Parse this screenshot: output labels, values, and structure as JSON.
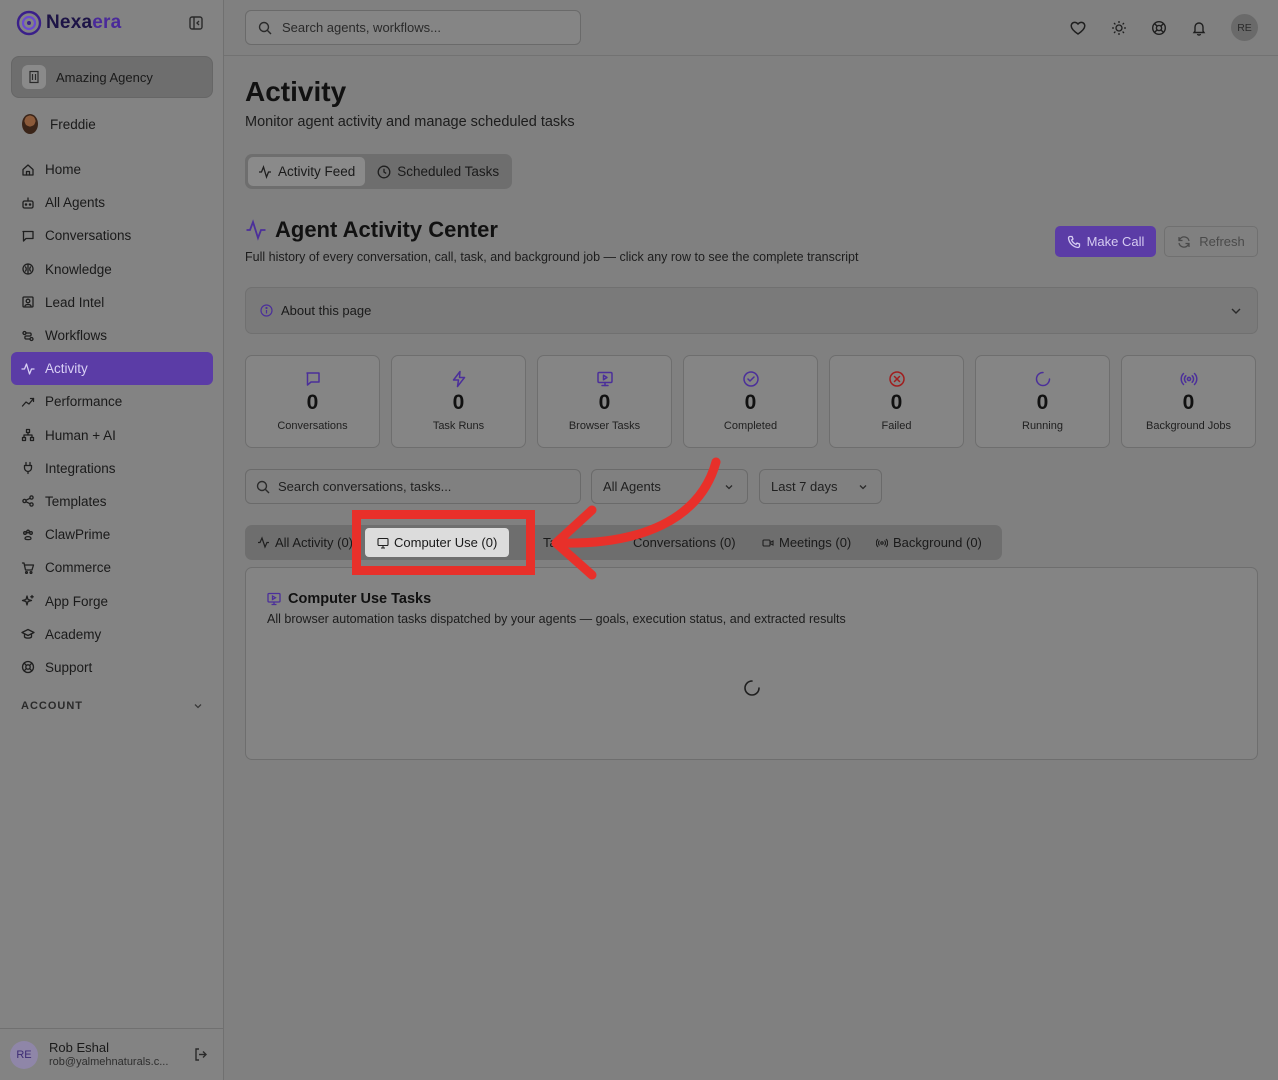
{
  "brand": {
    "name_part1": "Nexa",
    "name_part2": "era"
  },
  "sidebar": {
    "agency": "Amazing Agency",
    "user": "Freddie",
    "items": [
      {
        "label": "Home",
        "icon": "home-icon"
      },
      {
        "label": "All Agents",
        "icon": "bot-icon"
      },
      {
        "label": "Conversations",
        "icon": "message-icon"
      },
      {
        "label": "Knowledge",
        "icon": "brain-icon"
      },
      {
        "label": "Lead Intel",
        "icon": "contact-icon"
      },
      {
        "label": "Workflows",
        "icon": "workflow-icon"
      },
      {
        "label": "Activity",
        "icon": "activity-icon",
        "active": true
      },
      {
        "label": "Performance",
        "icon": "trending-icon"
      },
      {
        "label": "Human + AI",
        "icon": "network-icon"
      },
      {
        "label": "Integrations",
        "icon": "plug-icon"
      },
      {
        "label": "Templates",
        "icon": "share-icon"
      },
      {
        "label": "ClawPrime",
        "icon": "paw-icon"
      },
      {
        "label": "Commerce",
        "icon": "cart-icon"
      },
      {
        "label": "App Forge",
        "icon": "sparkles-icon"
      },
      {
        "label": "Academy",
        "icon": "graduation-icon"
      },
      {
        "label": "Support",
        "icon": "support-icon"
      }
    ],
    "account_label": "ACCOUNT",
    "footer": {
      "avatar": "RE",
      "name": "Rob Eshal",
      "email": "rob@yalmehnaturals.c..."
    }
  },
  "topbar": {
    "search_placeholder": "Search agents, workflows...",
    "avatar": "RE"
  },
  "page": {
    "title": "Activity",
    "subtitle": "Monitor agent activity and manage scheduled tasks",
    "tabs": [
      "Activity Feed",
      "Scheduled Tasks"
    ]
  },
  "center": {
    "title": "Agent Activity Center",
    "subtitle": "Full history of every conversation, call, task, and background job — click any row to see the complete transcript",
    "make_call": "Make Call",
    "refresh": "Refresh",
    "about": "About this page"
  },
  "stats": [
    {
      "value": "0",
      "label": "Conversations",
      "icon": "message-icon",
      "color": "#4b2f9a"
    },
    {
      "value": "0",
      "label": "Task Runs",
      "icon": "zap-icon",
      "color": "#4b2f9a"
    },
    {
      "value": "0",
      "label": "Browser Tasks",
      "icon": "monitor-icon",
      "color": "#4b2f9a"
    },
    {
      "value": "0",
      "label": "Completed",
      "icon": "check-circle-icon",
      "color": "#4b2f9a"
    },
    {
      "value": "0",
      "label": "Failed",
      "icon": "x-circle-icon",
      "color": "#a01d1d"
    },
    {
      "value": "0",
      "label": "Running",
      "icon": "loader-icon",
      "color": "#4b2f9a"
    },
    {
      "value": "0",
      "label": "Background Jobs",
      "icon": "radio-icon",
      "color": "#4b2f9a"
    }
  ],
  "filters": {
    "search_placeholder": "Search conversations, tasks...",
    "agents": "All Agents",
    "range": "Last 7 days"
  },
  "feed_tabs": {
    "all": "All Activity (0)",
    "computer_use": "Computer Use (0)",
    "tasks": "Tasks (0)",
    "conversations": "Conversations (0)",
    "meetings": "Meetings (0)",
    "background": "Background (0)"
  },
  "panel": {
    "title": "Computer Use Tasks",
    "subtitle": "All browser automation tasks dispatched by your agents — goals, execution status, and extracted results"
  },
  "colors": {
    "accent": "#5b3ca6",
    "annotation": "#e8302a"
  }
}
